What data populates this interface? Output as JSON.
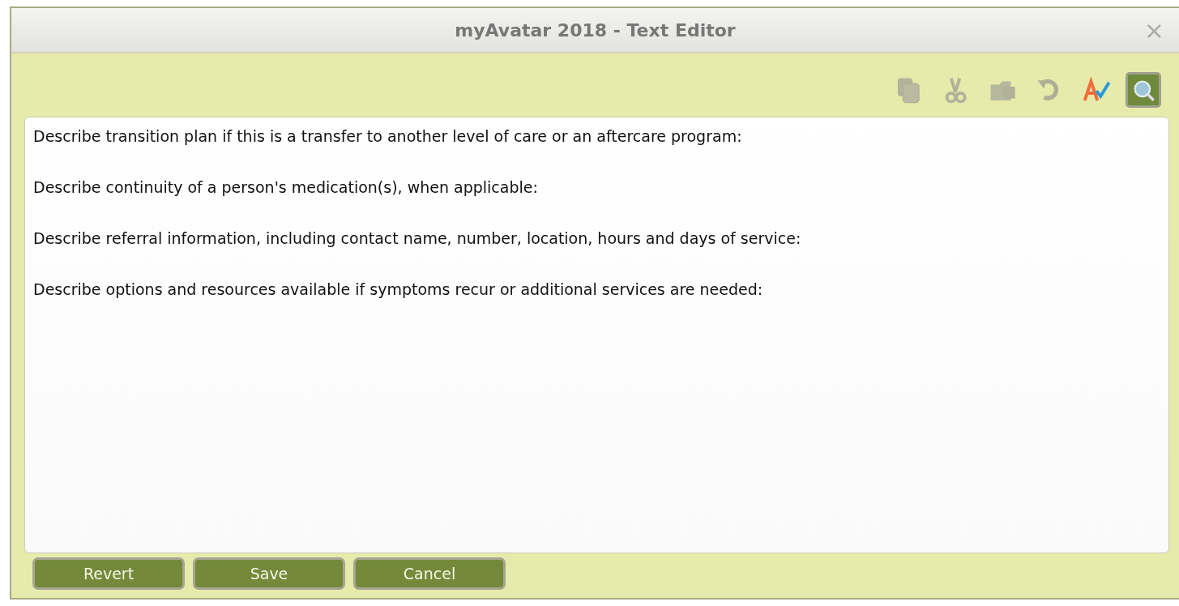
{
  "window": {
    "title": "myAvatar 2018 - Text Editor",
    "close": "×"
  },
  "toolbar": [
    {
      "kind": "copy",
      "disabled": true,
      "selected": false
    },
    {
      "kind": "cut",
      "disabled": true,
      "selected": false
    },
    {
      "kind": "paste",
      "disabled": true,
      "selected": false
    },
    {
      "kind": "undo",
      "disabled": true,
      "selected": false
    },
    {
      "kind": "spellcheck",
      "disabled": false,
      "selected": false
    },
    {
      "kind": "search",
      "disabled": false,
      "selected": true
    }
  ],
  "editor": {
    "paragraphs": [
      "Describe transition plan if this is a transfer to another level of care or an aftercare program:",
      "Describe continuity of a person's medication(s), when applicable:",
      "Describe referral information, including contact name, number, location, hours and days of service:",
      "Describe options and resources available if symptoms recur or additional services are needed:"
    ]
  },
  "buttons": [
    "Revert",
    "Save",
    "Cancel"
  ]
}
